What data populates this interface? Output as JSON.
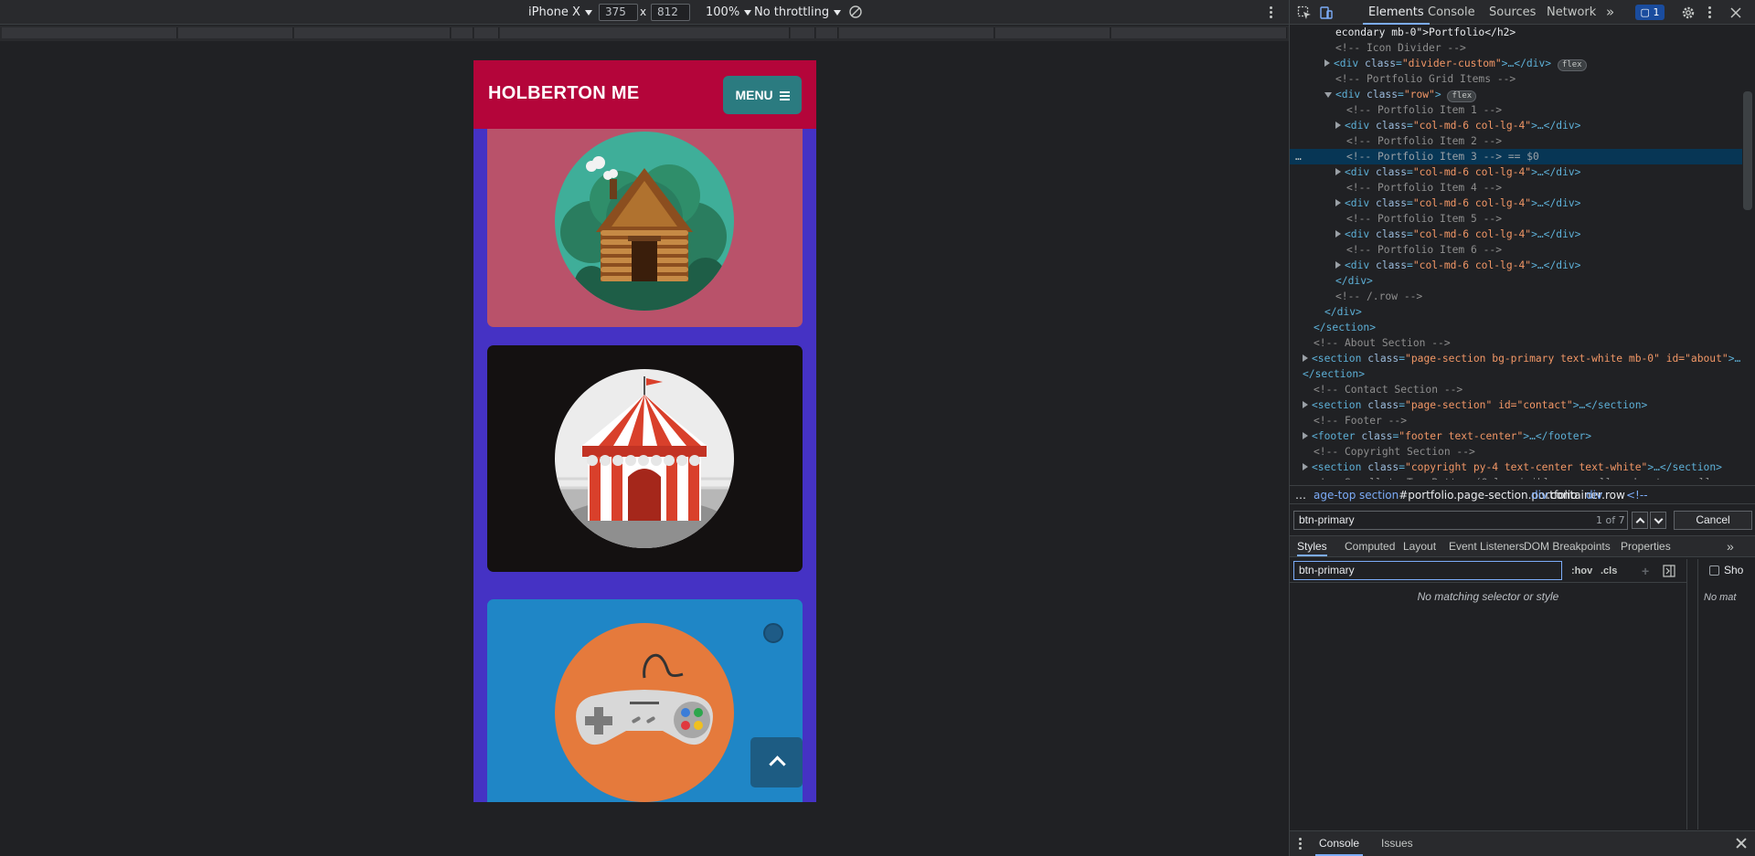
{
  "device_toolbar": {
    "device": "iPhone X",
    "width": "375",
    "times": "x",
    "height": "812",
    "zoom": "100%",
    "throttling": "No throttling"
  },
  "mobile_page": {
    "brand": "HOLBERTON ME",
    "menu_label": "MENU",
    "colors": {
      "navbar": "#b4053a",
      "menu_button": "#2b7b80",
      "background": "#4532c4"
    },
    "portfolio_items": [
      {
        "icon": "cabin-icon",
        "bg": "#b9526a"
      },
      {
        "icon": "circus-tent-icon",
        "bg": "#141111"
      },
      {
        "icon": "game-controller-icon",
        "bg": "#1f86c6"
      }
    ]
  },
  "devtools": {
    "tabs": [
      "Elements",
      "Console",
      "Sources",
      "Network"
    ],
    "more_tabs": "»",
    "issues_count": "1",
    "dom_lines": [
      {
        "indent": 5,
        "kind": "text",
        "text": "econdary mb-0\">Portfolio</h2>"
      },
      {
        "indent": 5,
        "kind": "comment",
        "text": "<!-- Icon Divider -->"
      },
      {
        "indent": 4,
        "kind": "tag",
        "arrow": "closed",
        "open": "<div ",
        "attr": "class",
        "val": "\"divider-custom\"",
        "close": ">…</div>",
        "badge": "flex"
      },
      {
        "indent": 5,
        "kind": "comment",
        "text": "<!-- Portfolio Grid Items -->"
      },
      {
        "indent": 4,
        "kind": "tag",
        "arrow": "open",
        "open": "<div ",
        "attr": "class",
        "val": "\"row\"",
        "close": ">",
        "badge": "flex"
      },
      {
        "indent": 6,
        "kind": "comment",
        "text": "<!-- Portfolio Item 1 -->"
      },
      {
        "indent": 5,
        "kind": "tag",
        "arrow": "closed",
        "open": "<div ",
        "attr": "class",
        "val": "\"col-md-6 col-lg-4\"",
        "close": ">…</div>"
      },
      {
        "indent": 6,
        "kind": "comment",
        "text": "<!-- Portfolio Item 2 -->"
      },
      {
        "indent": 6,
        "kind": "comment",
        "text": "<!-- Portfolio Item 3 --> == $0",
        "selected": true
      },
      {
        "indent": 5,
        "kind": "tag",
        "arrow": "closed",
        "open": "<div ",
        "attr": "class",
        "val": "\"col-md-6 col-lg-4\"",
        "close": ">…</div>"
      },
      {
        "indent": 6,
        "kind": "comment",
        "text": "<!-- Portfolio Item 4 -->"
      },
      {
        "indent": 5,
        "kind": "tag",
        "arrow": "closed",
        "open": "<div ",
        "attr": "class",
        "val": "\"col-md-6 col-lg-4\"",
        "close": ">…</div>"
      },
      {
        "indent": 6,
        "kind": "comment",
        "text": "<!-- Portfolio Item 5 -->"
      },
      {
        "indent": 5,
        "kind": "tag",
        "arrow": "closed",
        "open": "<div ",
        "attr": "class",
        "val": "\"col-md-6 col-lg-4\"",
        "close": ">…</div>"
      },
      {
        "indent": 6,
        "kind": "comment",
        "text": "<!-- Portfolio Item 6 -->"
      },
      {
        "indent": 5,
        "kind": "tag",
        "arrow": "closed",
        "open": "<div ",
        "attr": "class",
        "val": "\"col-md-6 col-lg-4\"",
        "close": ">…</div>"
      },
      {
        "indent": 5,
        "kind": "plain",
        "text": "</div>"
      },
      {
        "indent": 5,
        "kind": "comment",
        "text": "<!-- /.row -->"
      },
      {
        "indent": 4,
        "kind": "plain",
        "text": "</div>"
      },
      {
        "indent": 3,
        "kind": "plain",
        "text": "</section>"
      },
      {
        "indent": 3,
        "kind": "comment",
        "text": "<!-- About Section -->"
      },
      {
        "indent": 2,
        "kind": "tag",
        "arrow": "closed",
        "open": "<section ",
        "attr": "class",
        "val": "\"page-section bg-primary text-white mb-0\" id=\"about\"",
        "close": ">…"
      },
      {
        "indent": 2,
        "kind": "plain",
        "text": "</section>"
      },
      {
        "indent": 3,
        "kind": "comment",
        "text": "<!-- Contact Section -->"
      },
      {
        "indent": 2,
        "kind": "tag",
        "arrow": "closed",
        "open": "<section ",
        "attr": "class",
        "val": "\"page-section\" id=\"contact\"",
        "close": ">…</section>"
      },
      {
        "indent": 3,
        "kind": "comment",
        "text": "<!-- Footer -->"
      },
      {
        "indent": 2,
        "kind": "tag",
        "arrow": "closed",
        "open": "<footer ",
        "attr": "class",
        "val": "\"footer text-center\"",
        "close": ">…</footer>"
      },
      {
        "indent": 3,
        "kind": "comment",
        "text": "<!-- Copyright Section -->"
      },
      {
        "indent": 2,
        "kind": "tag",
        "arrow": "closed",
        "open": "<section ",
        "attr": "class",
        "val": "\"copyright py-4 text-center text-white\"",
        "close": ">…</section>"
      },
      {
        "indent": 3,
        "kind": "comment",
        "text": "<!-- Scroll to Top Button (Only visible on small and extra-small"
      }
    ],
    "breadcrumbs": [
      {
        "text": "…",
        "hl": ""
      },
      {
        "text": "age-top",
        "hl": ""
      },
      {
        "text": "section",
        "hl": "#portfolio.page-section.portfolio"
      },
      {
        "text": "div",
        "hl": ".container"
      },
      {
        "text": "div",
        "hl": ".row"
      },
      {
        "text": "<!--",
        "hl": ""
      }
    ],
    "search": {
      "value": "btn-primary",
      "match_count": "1 of 7",
      "cancel_label": "Cancel"
    },
    "styles_tabs": [
      "Styles",
      "Computed",
      "Layout",
      "Event Listeners",
      "DOM Breakpoints",
      "Properties"
    ],
    "styles_more": "»",
    "styles_filter": {
      "value": "btn-primary",
      "hov": ":hov",
      "cls": ".cls",
      "plus": "+"
    },
    "no_match_text": "No matching selector or style",
    "side_pane": {
      "show_label": "Sho",
      "no_match": "No mat"
    },
    "drawer_tabs": [
      "Console",
      "Issues"
    ]
  }
}
